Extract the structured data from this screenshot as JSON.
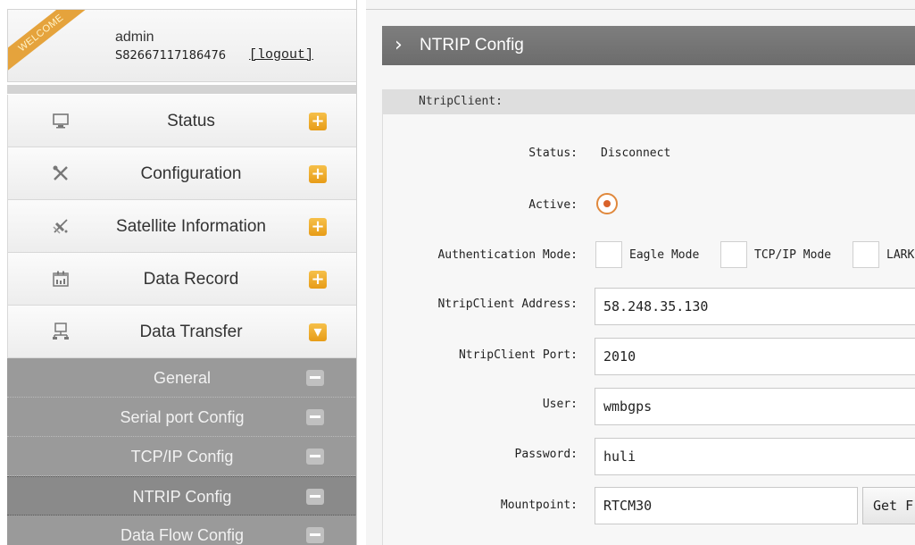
{
  "user": {
    "welcome": "WELCOME",
    "name": "admin",
    "serial": "S82667117186476",
    "logout": "[logout]"
  },
  "menu": [
    {
      "label": "Status",
      "icon": "monitor-icon",
      "toggle": "+"
    },
    {
      "label": "Configuration",
      "icon": "tools-icon",
      "toggle": "+"
    },
    {
      "label": "Satellite Information",
      "icon": "satellite-icon",
      "toggle": "+"
    },
    {
      "label": "Data Record",
      "icon": "calendar-icon",
      "toggle": "+"
    },
    {
      "label": "Data Transfer",
      "icon": "network-icon",
      "toggle": "▾"
    }
  ],
  "submenu": [
    {
      "label": "General"
    },
    {
      "label": "Serial port Config"
    },
    {
      "label": "TCP/IP Config"
    },
    {
      "label": "NTRIP Config",
      "active": true
    },
    {
      "label": "Data Flow Config"
    }
  ],
  "page": {
    "title": "NTRIP Config"
  },
  "form": {
    "section": "NtripClient:",
    "status_label": "Status:",
    "status_value": "Disconnect",
    "active_label": "Active:",
    "auth_label": "Authentication Mode:",
    "auth_options": [
      "Eagle Mode",
      "TCP/IP Mode",
      "LARK M"
    ],
    "address_label": "NtripClient Address:",
    "address_value": "58.248.35.130",
    "port_label": "NtripClient Port:",
    "port_value": "2010",
    "user_label": "User:",
    "user_value": "wmbgps",
    "password_label": "Password:",
    "password_value": "huli",
    "mountpoint_label": "Mountpoint:",
    "mountpoint_value": "RTCM30",
    "get_button": "Get F"
  },
  "colors": {
    "accent": "#e79c17",
    "header": "#757575",
    "submenu": "#9a9a9a",
    "radio": "#d9622b"
  }
}
